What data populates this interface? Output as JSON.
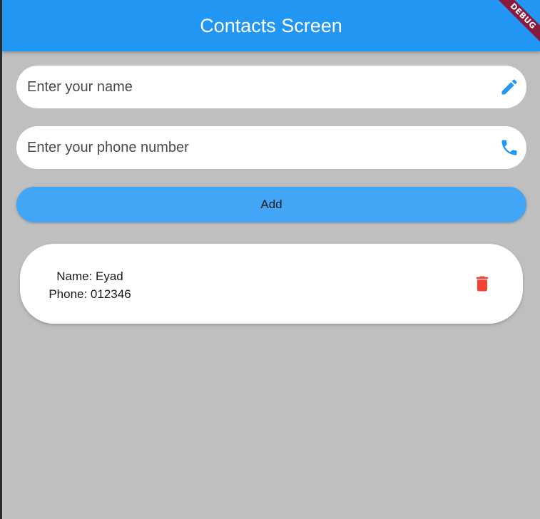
{
  "appbar": {
    "title": "Contacts Screen"
  },
  "form": {
    "name_placeholder": "Enter your name",
    "name_icon": "pencil-icon",
    "phone_placeholder": "Enter your phone number",
    "phone_icon": "phone-icon",
    "add_label": "Add"
  },
  "contacts": [
    {
      "name_line": "Name: Eyad",
      "phone_line": "Phone: 012346",
      "delete_icon": "trash-icon"
    }
  ],
  "debug_banner": "DEBUG",
  "colors": {
    "primary": "#2196f3",
    "button": "#42a5f5",
    "background": "#bfbfbf",
    "delete": "#f44336",
    "debug": "#8b1a3a"
  }
}
